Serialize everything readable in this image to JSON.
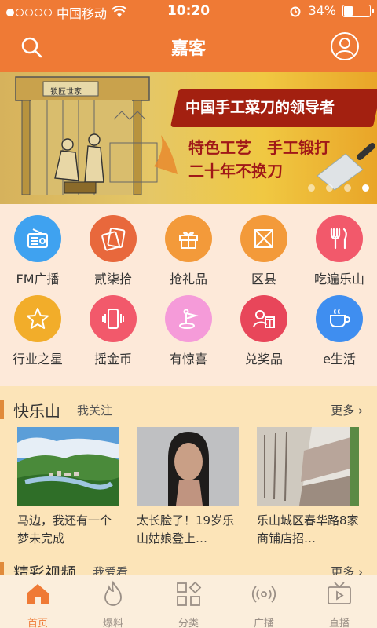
{
  "status": {
    "carrier": "中国移动",
    "time": "10:20",
    "battery": "34%",
    "battery_level": 0.34
  },
  "nav": {
    "title": "嘉客"
  },
  "banner": {
    "headline": "中国手工菜刀的领导者",
    "line1": "特色工艺　手工锻打",
    "line2": "二十年不换刀",
    "sign": "锁匠世家",
    "pages": 4,
    "active_page": 4
  },
  "grid": [
    {
      "label": "FM广播",
      "icon": "radio-icon",
      "color": "#3fa2f0"
    },
    {
      "label": "贰柒拾",
      "icon": "card-icon",
      "color": "#e8683c"
    },
    {
      "label": "抢礼品",
      "icon": "gift-icon",
      "color": "#f39a3a"
    },
    {
      "label": "区县",
      "icon": "map-icon",
      "color": "#f39a3a"
    },
    {
      "label": "吃遍乐山",
      "icon": "fork-knife-icon",
      "color": "#f2596b"
    },
    {
      "label": "行业之星",
      "icon": "star-icon",
      "color": "#f2ad2a"
    },
    {
      "label": "摇金币",
      "icon": "shake-phone-icon",
      "color": "#f2596b"
    },
    {
      "label": "有惊喜",
      "icon": "flag-icon",
      "color": "#f59bd9"
    },
    {
      "label": "兑奖品",
      "icon": "prize-icon",
      "color": "#e8465a"
    },
    {
      "label": "e生活",
      "icon": "cup-icon",
      "color": "#3f8ef0"
    }
  ],
  "section": {
    "title": "快乐山",
    "subtitle": "我关注",
    "more": "更多",
    "cards": [
      {
        "caption": "马边，我还有一个梦未完成"
      },
      {
        "caption": "太长脸了！19岁乐山姑娘登上…"
      },
      {
        "caption": "乐山城区春华路8家商铺店招…"
      }
    ]
  },
  "section2": {
    "title": "精彩视频",
    "subtitle": "我爱看",
    "more": "更多"
  },
  "tabs": [
    {
      "label": "首页",
      "icon": "home-icon",
      "active": true
    },
    {
      "label": "爆料",
      "icon": "flame-icon",
      "active": false
    },
    {
      "label": "分类",
      "icon": "category-icon",
      "active": false
    },
    {
      "label": "广播",
      "icon": "broadcast-icon",
      "active": false
    },
    {
      "label": "直播",
      "icon": "tv-icon",
      "active": false
    }
  ],
  "colors": {
    "accent": "#ef7a35",
    "section_bg": "#fce4b8",
    "grid_bg": "#fde9d9"
  }
}
